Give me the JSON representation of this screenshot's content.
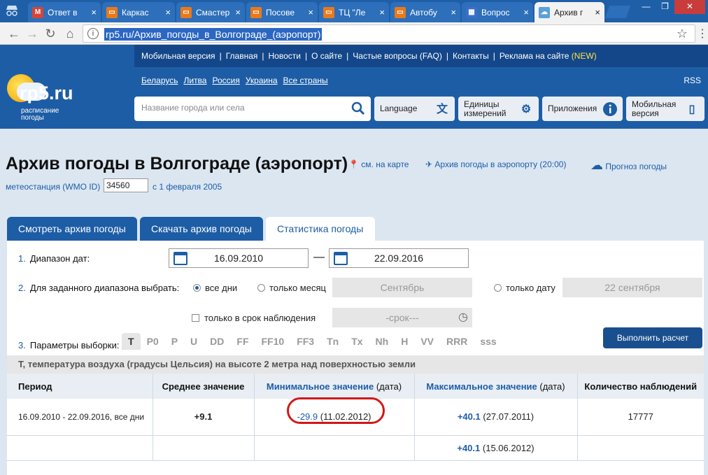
{
  "browser": {
    "tabs": [
      {
        "title": "Ответ в",
        "favicon_color": "#d44638",
        "favicon_letter": "M"
      },
      {
        "title": "Каркас",
        "favicon_color": "#e8791c",
        "favicon_letter": "▭"
      },
      {
        "title": "Смастер",
        "favicon_color": "#e8791c",
        "favicon_letter": "▭"
      },
      {
        "title": "Посове",
        "favicon_color": "#e8791c",
        "favicon_letter": "▭"
      },
      {
        "title": "ТЦ \"Ле",
        "favicon_color": "#e8791c",
        "favicon_letter": "▭"
      },
      {
        "title": "Автобу",
        "favicon_color": "#e8791c",
        "favicon_letter": "▭"
      },
      {
        "title": "Вопрос",
        "favicon_color": "#3b6fc4",
        "favicon_letter": "▦"
      },
      {
        "title": "Архив г",
        "favicon_color": "#5aa0d8",
        "favicon_letter": "☁"
      }
    ],
    "url": "rp5.ru/Архив_погоды_в_Волгограде_(аэропорт)"
  },
  "site": {
    "topnav": [
      "Мобильная версия",
      "Главная",
      "Новости",
      "О сайте",
      "Частые вопросы (FAQ)",
      "Контакты",
      "Реклама на сайте"
    ],
    "topnav_new": "(NEW)",
    "logo_name": "rp5.ru",
    "logo_sub1": "расписание",
    "logo_sub2": "погоды",
    "countries": [
      "Беларусь",
      "Литва",
      "Россия",
      "Украина",
      "Все страны"
    ],
    "rss": "RSS",
    "search_placeholder": "Название города или села",
    "buttons": {
      "language": "Language",
      "units1": "Единицы",
      "units2": "измерений",
      "apps": "Приложения",
      "mobile1": "Мобильная",
      "mobile2": "версия"
    }
  },
  "page": {
    "title": "Архив погоды в Волгограде (аэропорт)",
    "map_link": "см. на карте",
    "airport_link": "Архив погоды в аэропорту (20:00)",
    "forecast_link": "Прогноз погоды",
    "wmo_label": "метеостанция (WMO ID)",
    "wmo_value": "34560",
    "since": "с 1 февраля 2005",
    "tabs": [
      "Смотреть архив погоды",
      "Скачать архив погоды",
      "Статистика погоды"
    ]
  },
  "form": {
    "step1_num": "1.",
    "step1_label": "Диапазон дат:",
    "date_from": "16.09.2010",
    "dash": "—",
    "date_to": "22.09.2016",
    "step2_num": "2.",
    "step2_label": "Для заданного диапазона выбрать:",
    "opt_all": "все дни",
    "opt_month": "только месяц",
    "month_value": "Сентябрь",
    "opt_date": "только дату",
    "date_value": "22 сентября",
    "opt_term": "только в срок наблюдения",
    "term_value": "-срок---",
    "step3_num": "3.",
    "step3_label": "Параметры выборки:",
    "params": [
      "T",
      "P0",
      "P",
      "U",
      "DD",
      "FF",
      "FF10",
      "FF3",
      "Tn",
      "Tx",
      "Nh",
      "H",
      "VV",
      "RRR",
      "sss"
    ],
    "calc_button": "Выполнить расчет"
  },
  "results": {
    "param_desc": "T, температура воздуха (градусы Цельсия) на высоте 2 метра над поверхностью земли",
    "headers": {
      "period": "Период",
      "avg": "Среднее значение",
      "min_main": "Минимальное значение",
      "min_date": "(дата)",
      "max_main": "Максимальное значение",
      "max_date": "(дата)",
      "count": "Количество наблюдений"
    },
    "row1": {
      "period": "16.09.2010 - 22.09.2016, все дни",
      "avg": "+9.1",
      "min_val": "-29.9",
      "min_date": "(11.02.2012)",
      "max_val": "+40.1",
      "max_date": "(27.07.2011)",
      "count": "17777"
    },
    "row2": {
      "max_val": "+40.1",
      "max_date": "(15.06.2012)"
    },
    "highlight_color": "#d11818"
  }
}
